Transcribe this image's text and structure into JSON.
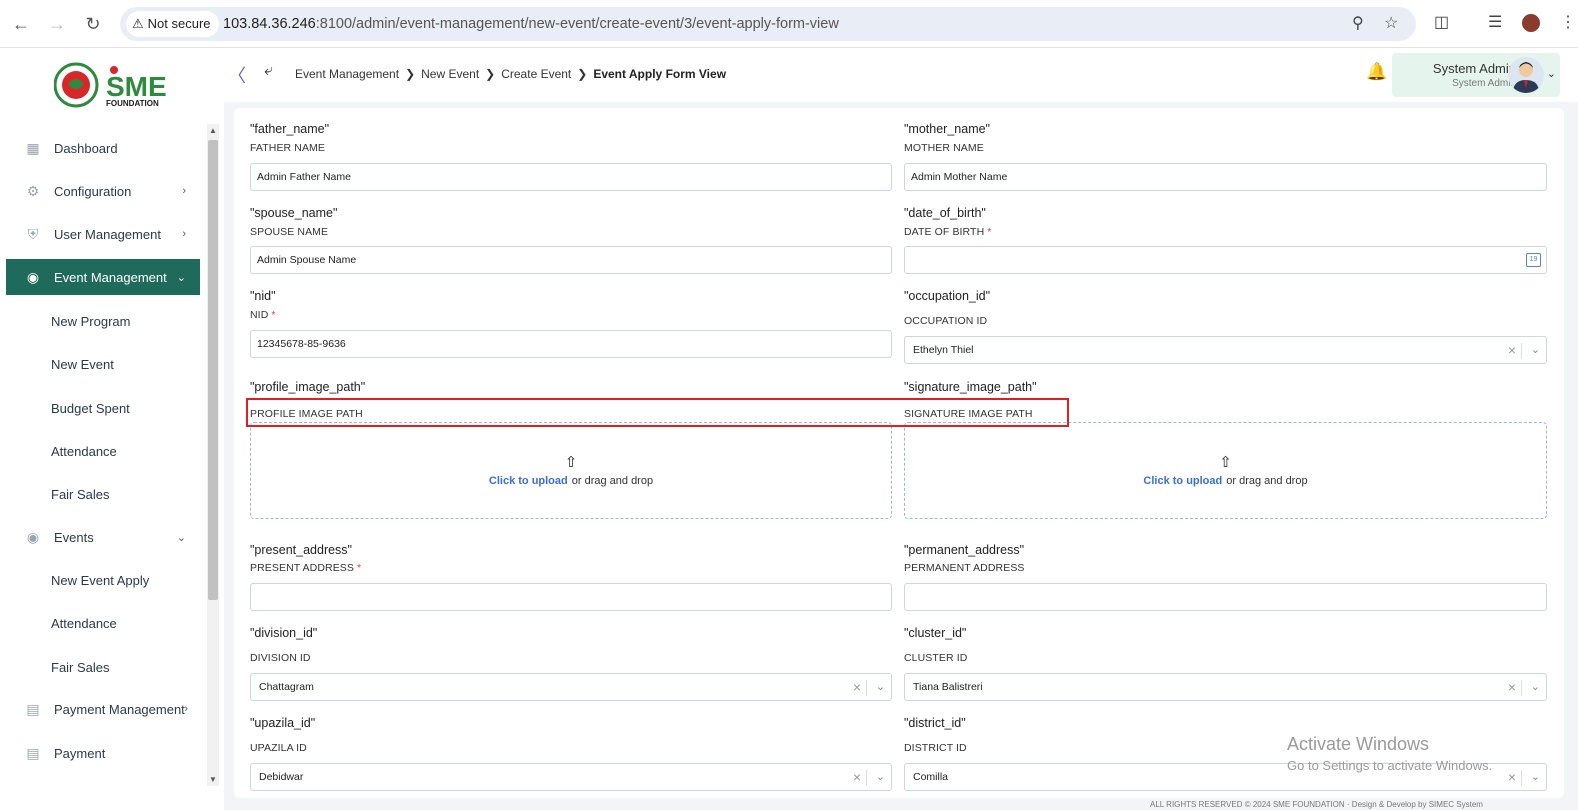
{
  "browser": {
    "secure_label": "Not secure",
    "url_host": "103.84.36.246",
    "url_path": ":8100/admin/event-management/new-event/create-event/3/event-apply-form-view"
  },
  "header": {
    "logo_text": "SME",
    "logo_sub": "FOUNDATION",
    "breadcrumb": [
      "Event Management",
      "New Event",
      "Create Event",
      "Event Apply Form View"
    ],
    "user_name": "System Admin",
    "user_role": "System Admin"
  },
  "sidebar": {
    "items": [
      {
        "label": "Dashboard"
      },
      {
        "label": "Configuration"
      },
      {
        "label": "User Management"
      },
      {
        "label": "Event Management"
      },
      {
        "label": "New Program"
      },
      {
        "label": "New Event"
      },
      {
        "label": "Budget Spent"
      },
      {
        "label": "Attendance"
      },
      {
        "label": "Fair Sales"
      },
      {
        "label": "Events"
      },
      {
        "label": "New Event Apply"
      },
      {
        "label": "Attendance"
      },
      {
        "label": "Fair Sales"
      },
      {
        "label": "Payment Management"
      },
      {
        "label": "Payment"
      }
    ]
  },
  "form": {
    "father": {
      "key": "\"father_name\"",
      "label": "FATHER NAME",
      "value": "Admin Father Name"
    },
    "mother": {
      "key": "\"mother_name\"",
      "label": "MOTHER NAME",
      "value": "Admin Mother Name"
    },
    "spouse": {
      "key": "\"spouse_name\"",
      "label": "SPOUSE NAME",
      "value": "Admin Spouse Name"
    },
    "dob": {
      "key": "\"date_of_birth\"",
      "label": "DATE OF BIRTH",
      "value": "",
      "calendar_text": "19"
    },
    "nid": {
      "key": "\"nid\"",
      "label": "NID",
      "value": "12345678-85-9636"
    },
    "occupation": {
      "key": "\"occupation_id\"",
      "label": "OCCUPATION ID",
      "value": "Ethelyn Thiel"
    },
    "profile_image": {
      "key": "\"profile_image_path\"",
      "label": "PROFILE IMAGE PATH"
    },
    "signature_image": {
      "key": "\"signature_image_path\"",
      "label": "SIGNATURE IMAGE PATH"
    },
    "upload": {
      "link": "Click to upload",
      "rest": "or drag and drop"
    },
    "present_address": {
      "key": "\"present_address\"",
      "label": "PRESENT ADDRESS",
      "value": ""
    },
    "permanent_address": {
      "key": "\"permanent_address\"",
      "label": "PERMANENT ADDRESS",
      "value": ""
    },
    "division": {
      "key": "\"division_id\"",
      "label": "DIVISION ID",
      "value": "Chattagram"
    },
    "cluster": {
      "key": "\"cluster_id\"",
      "label": "CLUSTER ID",
      "value": "Tiana Balistreri"
    },
    "upazila": {
      "key": "\"upazila_id\"",
      "label": "UPAZILA ID",
      "value": "Debidwar"
    },
    "district": {
      "key": "\"district_id\"",
      "label": "DISTRICT ID",
      "value": "Comilla"
    },
    "required_mark": "*"
  },
  "watermark": {
    "line1": "Activate Windows",
    "line2": "Go to Settings to activate Windows."
  },
  "footer": {
    "text": "ALL RIGHTS RESERVED © 2024 SME FOUNDATION · Design & Develop by SIMEC System"
  }
}
